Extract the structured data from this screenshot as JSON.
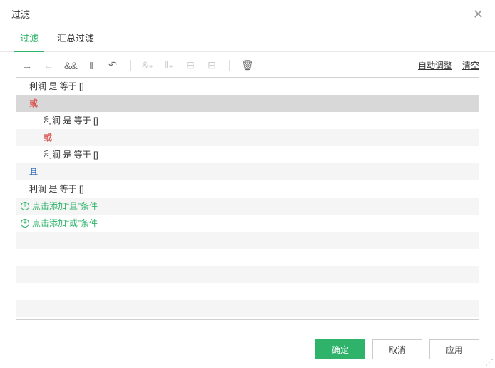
{
  "dialog": {
    "title": "过滤"
  },
  "tabs": {
    "filter": "过滤",
    "summary": "汇总过滤"
  },
  "toolbar": {
    "auto_adjust": "自动调整",
    "clear": "清空"
  },
  "rules": {
    "cond1": "利润 是 等于 []",
    "op_or": "或",
    "cond2": "利润 是 等于 []",
    "op_or2": "或",
    "cond3": "利润 是 等于 []",
    "op_and": "且",
    "cond4": "利润 是 等于 []",
    "add_and": "点击添加“且”条件",
    "add_or": "点击添加“或”条件"
  },
  "footer": {
    "ok": "确定",
    "cancel": "取消",
    "apply": "应用"
  }
}
